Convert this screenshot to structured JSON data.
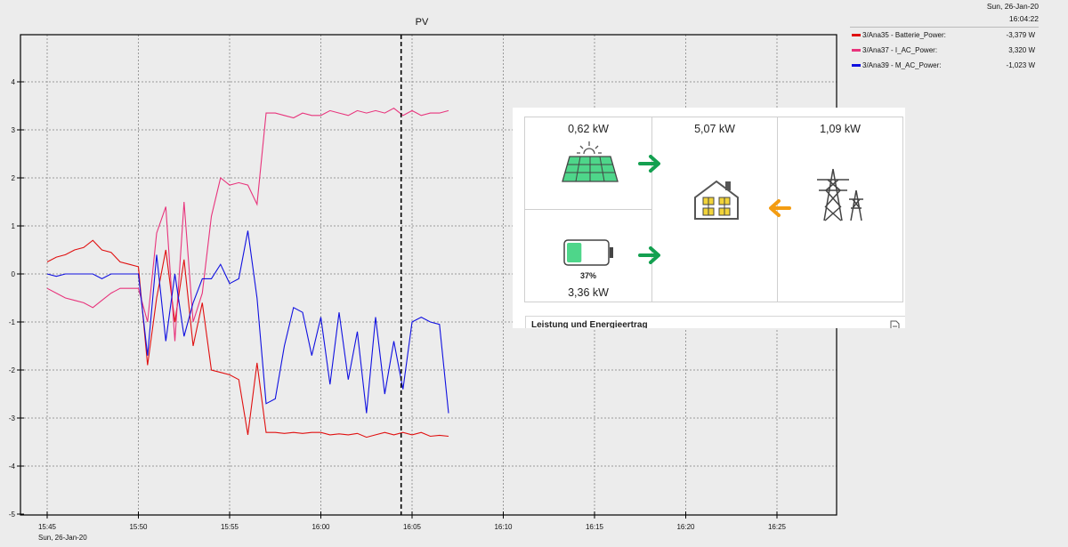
{
  "chart_data": {
    "type": "line",
    "title": "PV",
    "x_ticks": [
      "15:45",
      "15:50",
      "15:55",
      "16:00",
      "16:05",
      "16:10",
      "16:15",
      "16:20",
      "16:25"
    ],
    "x_date_label": "Sun, 26-Jan-20",
    "y_ticks": [
      "4",
      "3",
      "2",
      "1",
      "0",
      "-1",
      "-2",
      "-3",
      "-4",
      "-5"
    ],
    "ylim": [
      -5,
      5
    ],
    "xlim_minutes": [
      0,
      45
    ],
    "cursor_minute": 19.4,
    "grid": true,
    "series": [
      {
        "name": "3/Ana35 - Batterie_Power:",
        "color": "#e01010",
        "x": [
          0,
          0.5,
          1,
          1.5,
          2,
          2.5,
          3,
          3.5,
          4,
          4.5,
          5,
          5.5,
          6,
          6.5,
          7,
          7.5,
          8,
          8.5,
          9,
          9.5,
          10,
          10.5,
          11,
          11.5,
          12,
          12.5,
          13,
          13.5,
          14,
          14.5,
          15,
          15.5,
          16,
          16.5,
          17,
          17.5,
          18,
          18.5,
          19,
          19.5,
          20,
          20.5,
          21,
          21.5,
          22
        ],
        "values": [
          0.25,
          0.35,
          0.4,
          0.5,
          0.55,
          0.7,
          0.5,
          0.45,
          0.25,
          0.2,
          0.15,
          -1.9,
          -0.5,
          0.5,
          -1.0,
          0.3,
          -1.5,
          -0.6,
          -2.0,
          -2.05,
          -2.1,
          -2.2,
          -3.35,
          -1.85,
          -3.3,
          -3.3,
          -3.32,
          -3.3,
          -3.32,
          -3.3,
          -3.3,
          -3.35,
          -3.33,
          -3.35,
          -3.32,
          -3.4,
          -3.35,
          -3.3,
          -3.35,
          -3.3,
          -3.35,
          -3.3,
          -3.38,
          -3.36,
          -3.38
        ]
      },
      {
        "name": "3/Ana37 - I_AC_Power:",
        "color": "#e8347c",
        "x": [
          0,
          0.5,
          1,
          1.5,
          2,
          2.5,
          3,
          3.5,
          4,
          4.5,
          5,
          5.5,
          6,
          6.5,
          7,
          7.5,
          8,
          8.5,
          9,
          9.5,
          10,
          10.5,
          11,
          11.5,
          12,
          12.5,
          13,
          13.5,
          14,
          14.5,
          15,
          15.5,
          16,
          16.5,
          17,
          17.5,
          18,
          18.5,
          19,
          19.5,
          20,
          20.5,
          21,
          21.5,
          22
        ],
        "values": [
          -0.3,
          -0.4,
          -0.5,
          -0.55,
          -0.6,
          -0.7,
          -0.55,
          -0.4,
          -0.3,
          -0.3,
          -0.3,
          -1.0,
          0.85,
          1.4,
          -1.4,
          1.5,
          -1.0,
          -0.4,
          1.2,
          2.0,
          1.85,
          1.9,
          1.85,
          1.45,
          3.35,
          3.35,
          3.3,
          3.25,
          3.35,
          3.3,
          3.3,
          3.4,
          3.35,
          3.3,
          3.4,
          3.35,
          3.4,
          3.35,
          3.45,
          3.3,
          3.4,
          3.3,
          3.35,
          3.35,
          3.4
        ]
      },
      {
        "name": "3/Ana39 - M_AC_Power:",
        "color": "#1010e0",
        "x": [
          0,
          0.5,
          1,
          1.5,
          2,
          2.5,
          3,
          3.5,
          4,
          4.5,
          5,
          5.5,
          6,
          6.5,
          7,
          7.5,
          8,
          8.5,
          9,
          9.5,
          10,
          10.5,
          11,
          11.5,
          12,
          12.5,
          13,
          13.5,
          14,
          14.5,
          15,
          15.5,
          16,
          16.5,
          17,
          17.5,
          18,
          18.5,
          19,
          19.5,
          20,
          20.5,
          21,
          21.5,
          22
        ],
        "values": [
          0,
          -0.05,
          0,
          0,
          0,
          0,
          -0.1,
          0,
          0,
          0,
          0,
          -1.7,
          0.4,
          -1.4,
          0,
          -1.3,
          -0.6,
          -0.1,
          -0.1,
          0.2,
          -0.2,
          -0.1,
          0.9,
          -0.5,
          -2.7,
          -2.6,
          -1.5,
          -0.7,
          -0.8,
          -1.7,
          -0.9,
          -2.3,
          -0.8,
          -2.2,
          -1.2,
          -2.9,
          -0.9,
          -2.5,
          -1.4,
          -2.4,
          -1.0,
          -0.9,
          -1.0,
          -1.05,
          -2.9
        ]
      }
    ]
  },
  "legend": {
    "date": "Sun, 26-Jan-20",
    "time": "16:04:22",
    "items": [
      {
        "name": "3/Ana35 - Batterie_Power:",
        "value": "-3,379 W",
        "color": "#e01010"
      },
      {
        "name": "3/Ana37 - I_AC_Power:",
        "value": "3,320 W",
        "color": "#e8347c"
      },
      {
        "name": "3/Ana39 - M_AC_Power:",
        "value": "-1,023 W",
        "color": "#1010e0"
      }
    ]
  },
  "energy_panel": {
    "pv_power": "0,62 kW",
    "house_power": "5,07 kW",
    "grid_power": "1,09 kW",
    "battery_soc": "37%",
    "battery_soc_fraction": 0.37,
    "battery_power": "3,36 kW",
    "footer_title": "Leistung und Energieertrag",
    "colors": {
      "flow_green": "#14a050",
      "flow_orange": "#f39c12",
      "pv_green": "#4ed68a"
    },
    "icons": [
      "sun-icon",
      "solar-panel-icon",
      "battery-icon",
      "house-icon",
      "power-tower-icon",
      "arrow-right-icon",
      "arrow-left-icon",
      "document-icon"
    ]
  }
}
